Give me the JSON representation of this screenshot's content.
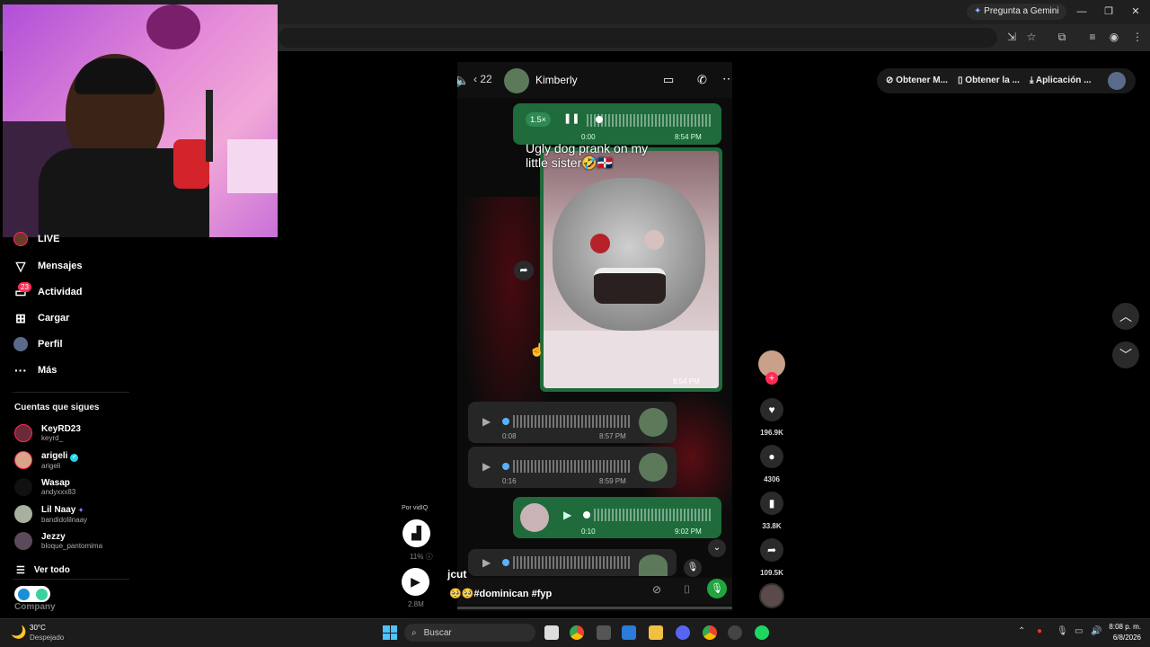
{
  "browser": {
    "gemini_label": "Pregunta a Gemini",
    "toolbar_pills": [
      "Obtener M...",
      "Obtener la ...",
      "Aplicación ..."
    ]
  },
  "sidebar": {
    "items": [
      {
        "label": "LIVE",
        "icon": "live-avatar-icon"
      },
      {
        "label": "Mensajes",
        "icon": "paper-plane-icon"
      },
      {
        "label": "Actividad",
        "icon": "activity-icon",
        "badge": "23"
      },
      {
        "label": "Cargar",
        "icon": "plus-square-icon"
      },
      {
        "label": "Perfil",
        "icon": "avatar-icon"
      },
      {
        "label": "Más",
        "icon": "more-dots-icon"
      }
    ],
    "following_title": "Cuentas que sigues",
    "accounts": [
      {
        "name": "KeyRD23",
        "handle": "keyrd_"
      },
      {
        "name": "arigeli",
        "handle": "arigeli"
      },
      {
        "name": "Wasap",
        "handle": "andyxxx83"
      },
      {
        "name": "Lil  Naay",
        "handle": "bandidolilnaay"
      },
      {
        "name": "Jezzy",
        "handle": "bloque_pantomima"
      }
    ],
    "see_all": "Ver todo",
    "company": "Company"
  },
  "video": {
    "back_count": "22",
    "contact_name": "Kimberly",
    "speed": "1.5×",
    "msg1_time_left": "0:00",
    "msg1_time_right": "8:54 PM",
    "caption_overlay": "Ugly dog prank on my little sister🤣🇩🇴",
    "photo_time": "8:54 PM",
    "voice_msgs": [
      {
        "duration": "0:08",
        "time": "8:57 PM"
      },
      {
        "duration": "0:16",
        "time": "8:59 PM"
      },
      {
        "duration": "0:10",
        "time": "9:02 PM"
      }
    ],
    "author": "jcut",
    "description": "🥺🥺#dominican #fyp"
  },
  "actions": {
    "likes": "196.9K",
    "comments": "4306",
    "saves": "33.8K",
    "shares": "109.5K"
  },
  "vidiq": {
    "label": "Por vidIQ",
    "percent": "11%",
    "views": "2.8M"
  },
  "taskbar": {
    "weather_temp": "30°C",
    "weather_desc": "Despejado",
    "search_placeholder": "Buscar",
    "time": "8:08 p. m.",
    "date": "6/8/2026"
  },
  "colors": {
    "accent_red": "#fe2c55",
    "whatsapp_green": "#1f6b3b"
  }
}
